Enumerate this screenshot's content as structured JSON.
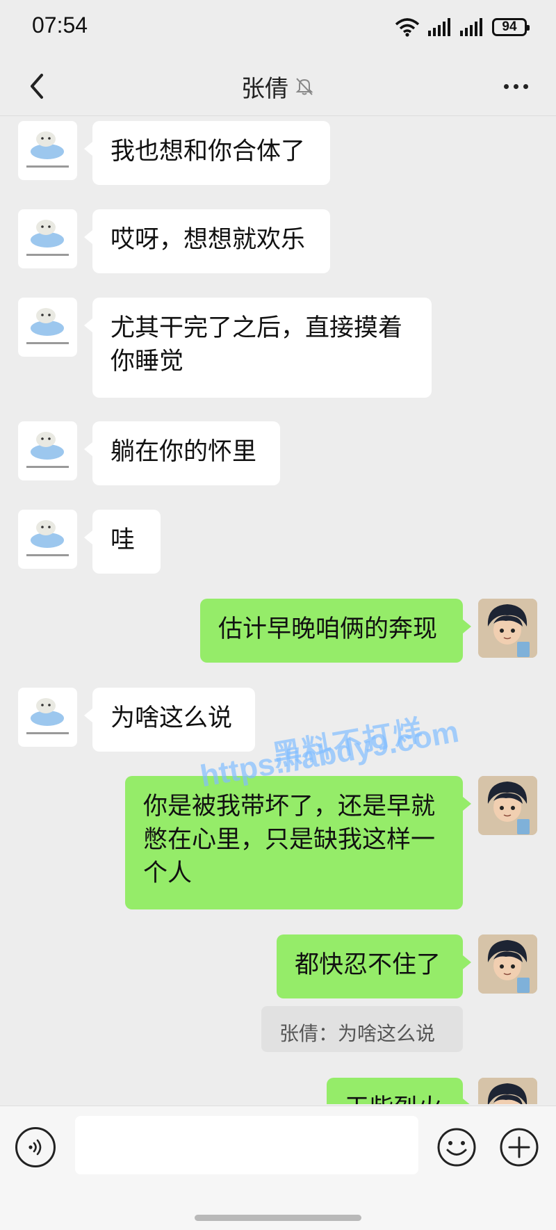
{
  "status_bar": {
    "time": "07:54",
    "battery": "94"
  },
  "header": {
    "title": "张倩"
  },
  "messages": [
    {
      "side": "left",
      "text": "我也想和你合体了"
    },
    {
      "side": "left",
      "text": "哎呀，想想就欢乐"
    },
    {
      "side": "left",
      "text": "尤其干完了之后，直接摸着\n你睡觉"
    },
    {
      "side": "left",
      "text": "躺在你的怀里"
    },
    {
      "side": "left",
      "text": "哇"
    },
    {
      "side": "right",
      "text": "估计早晚咱俩的奔现"
    },
    {
      "side": "left",
      "text": "为啥这么说"
    },
    {
      "side": "right",
      "text": "你是被我带坏了，还是早就\n憋在心里，只是缺我这样一\n个人"
    },
    {
      "side": "right",
      "text": "都快忍不住了",
      "quote": "张倩：为啥这么说"
    },
    {
      "side": "right",
      "text": "干柴烈火"
    }
  ],
  "watermark": {
    "line1": "黑料不打烊",
    "line2": "https://abdy9.com"
  },
  "input": {
    "placeholder": ""
  },
  "colors": {
    "self_bubble": "#95ec69",
    "other_bubble": "#ffffff",
    "background": "#ededed"
  }
}
